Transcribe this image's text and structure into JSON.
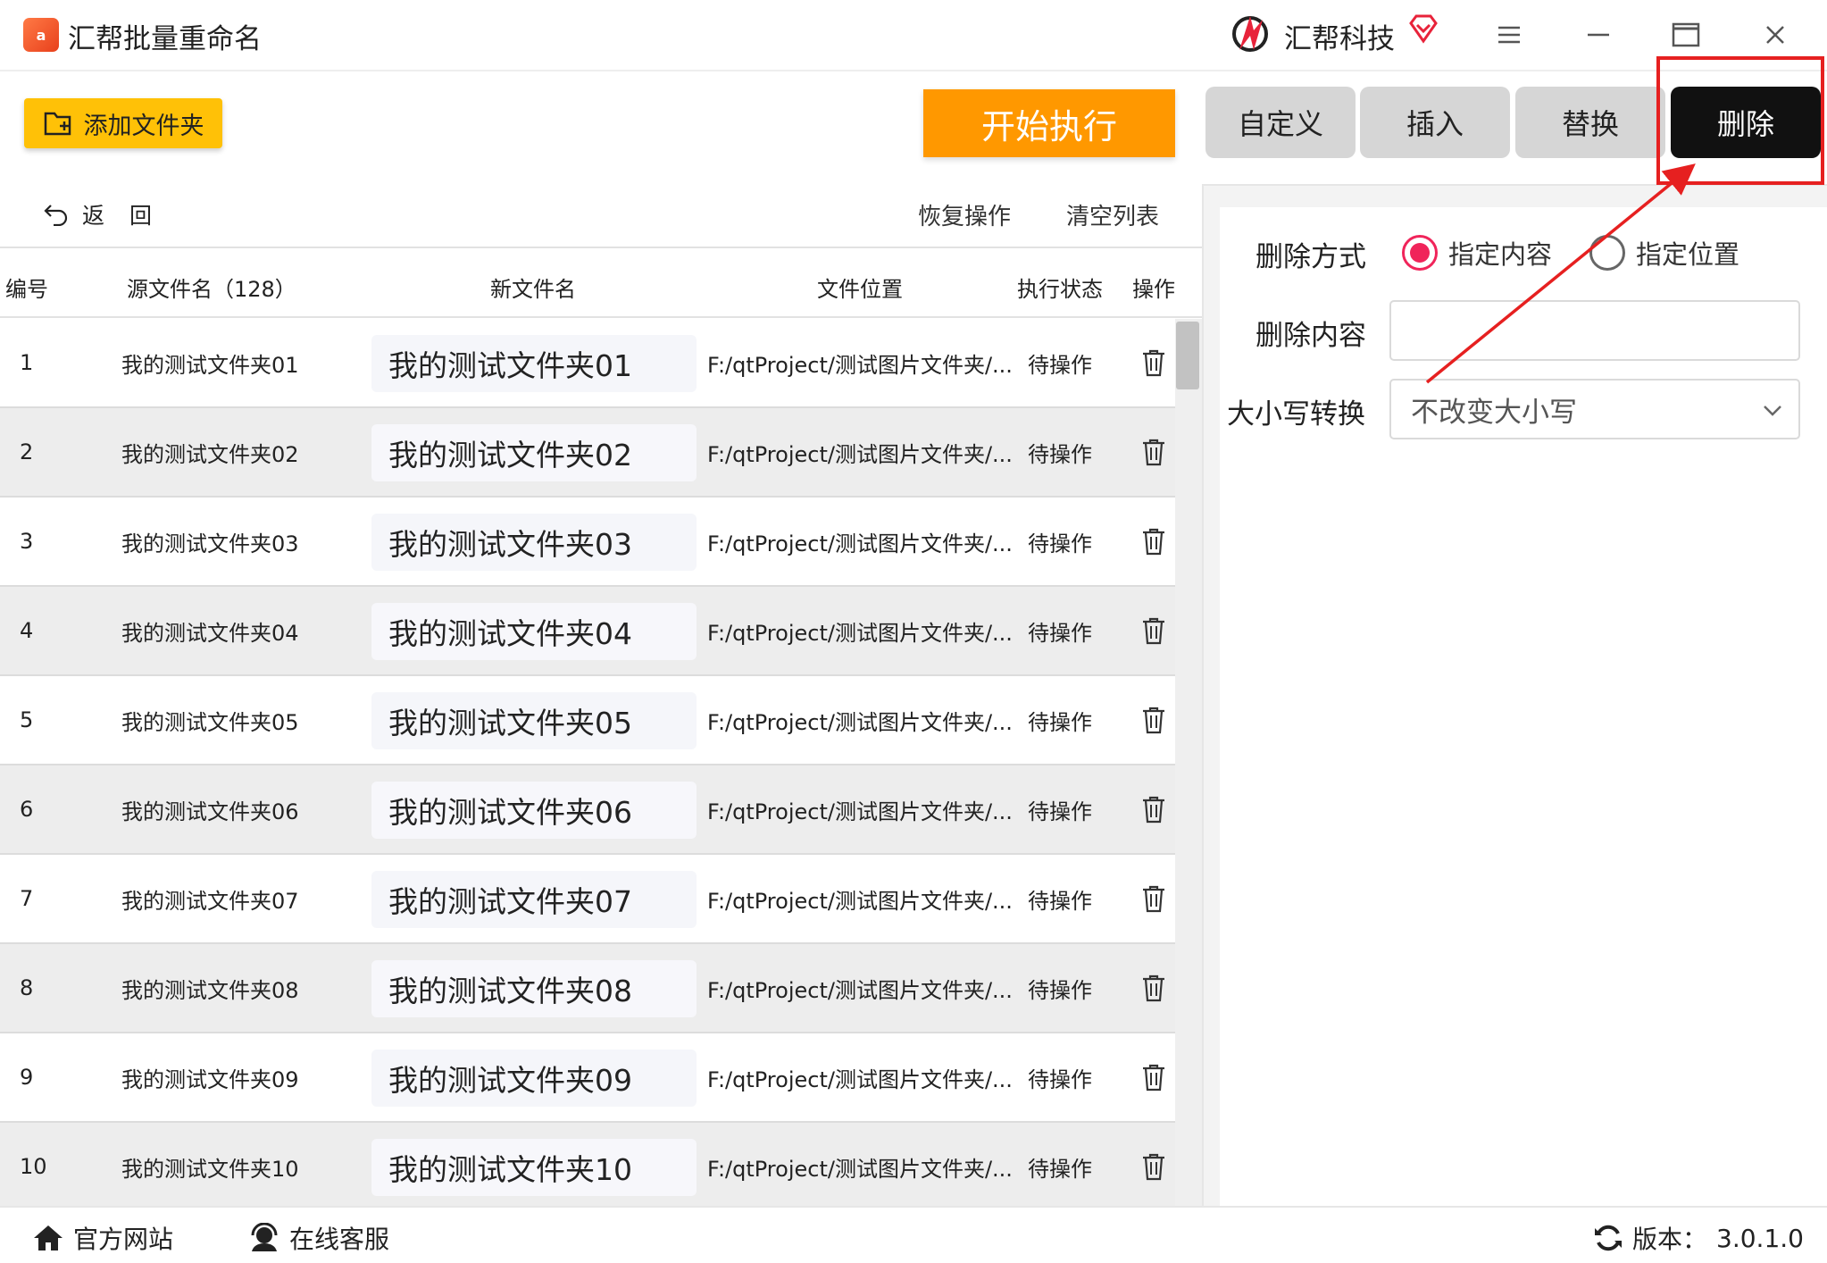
{
  "app": {
    "title": "汇帮批量重命名",
    "logo_text": "a",
    "brand_name": "汇帮科技"
  },
  "toolbar": {
    "add_folder": "添加文件夹",
    "start": "开始执行"
  },
  "tabs": [
    {
      "label": "自定义",
      "active": false
    },
    {
      "label": "插入",
      "active": false
    },
    {
      "label": "替换",
      "active": false
    },
    {
      "label": "删除",
      "active": true
    }
  ],
  "list_actions": {
    "back": "返回",
    "restore": "恢复操作",
    "clear": "清空列表"
  },
  "table": {
    "headers": {
      "index": "编号",
      "source": "源文件名（128）",
      "newname": "新文件名",
      "location": "文件位置",
      "status": "执行状态",
      "action": "操作"
    },
    "rows": [
      {
        "index": "1",
        "source": "我的测试文件夹01",
        "newname": "我的测试文件夹01",
        "location": "F:/qtProject/测试图片文件夹/...",
        "status": "待操作"
      },
      {
        "index": "2",
        "source": "我的测试文件夹02",
        "newname": "我的测试文件夹02",
        "location": "F:/qtProject/测试图片文件夹/...",
        "status": "待操作"
      },
      {
        "index": "3",
        "source": "我的测试文件夹03",
        "newname": "我的测试文件夹03",
        "location": "F:/qtProject/测试图片文件夹/...",
        "status": "待操作"
      },
      {
        "index": "4",
        "source": "我的测试文件夹04",
        "newname": "我的测试文件夹04",
        "location": "F:/qtProject/测试图片文件夹/...",
        "status": "待操作"
      },
      {
        "index": "5",
        "source": "我的测试文件夹05",
        "newname": "我的测试文件夹05",
        "location": "F:/qtProject/测试图片文件夹/...",
        "status": "待操作"
      },
      {
        "index": "6",
        "source": "我的测试文件夹06",
        "newname": "我的测试文件夹06",
        "location": "F:/qtProject/测试图片文件夹/...",
        "status": "待操作"
      },
      {
        "index": "7",
        "source": "我的测试文件夹07",
        "newname": "我的测试文件夹07",
        "location": "F:/qtProject/测试图片文件夹/...",
        "status": "待操作"
      },
      {
        "index": "8",
        "source": "我的测试文件夹08",
        "newname": "我的测试文件夹08",
        "location": "F:/qtProject/测试图片文件夹/...",
        "status": "待操作"
      },
      {
        "index": "9",
        "source": "我的测试文件夹09",
        "newname": "我的测试文件夹09",
        "location": "F:/qtProject/测试图片文件夹/...",
        "status": "待操作"
      },
      {
        "index": "10",
        "source": "我的测试文件夹10",
        "newname": "我的测试文件夹10",
        "location": "F:/qtProject/测试图片文件夹/...",
        "status": "待操作"
      }
    ]
  },
  "panel": {
    "mode_label": "删除方式",
    "mode_options": [
      "指定内容",
      "指定位置"
    ],
    "mode_selected": "指定内容",
    "content_label": "删除内容",
    "content_value": "",
    "case_label": "大小写转换",
    "case_value": "不改变大小写"
  },
  "statusbar": {
    "website": "官方网站",
    "support": "在线客服",
    "version_label": "版本：",
    "version": "3.0.1.0"
  },
  "colors": {
    "accent_yellow": "#ffc107",
    "accent_orange": "#ff9800",
    "active_tab": "#111111",
    "radio_on": "#f0245a",
    "annotation_red": "#e62020"
  }
}
